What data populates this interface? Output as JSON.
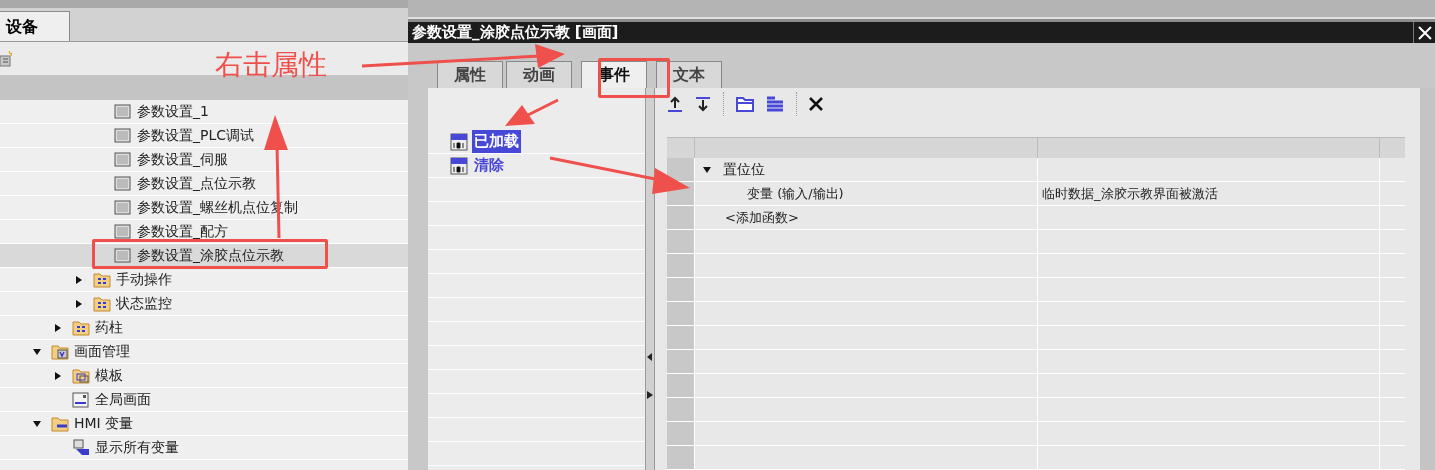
{
  "device_tab": {
    "label": "设备",
    "selected": true
  },
  "tree": {
    "items": [
      {
        "children": [
          {
            "children": [
              {
                "children": [
                  {
                    "kind": "screen",
                    "label": "参数设置_1",
                    "selected": false
                  },
                  {
                    "kind": "screen",
                    "label": "参数设置_PLC调试",
                    "selected": false
                  },
                  {
                    "kind": "screen",
                    "label": "参数设置_伺服",
                    "selected": false
                  },
                  {
                    "kind": "screen",
                    "label": "参数设置_点位示教",
                    "selected": false
                  },
                  {
                    "kind": "screen",
                    "label": "参数设置_螺丝机点位复制",
                    "selected": false
                  },
                  {
                    "kind": "screen",
                    "label": "参数设置_配方",
                    "selected": false
                  },
                  {
                    "kind": "screen",
                    "label": "参数设置_涂胶点位示教",
                    "selected": true
                  }
                ]
              },
              {
                "kind": "folder",
                "label": "手动操作",
                "expanded": false,
                "selected": false
              },
              {
                "kind": "folder",
                "label": "状态监控",
                "expanded": false,
                "selected": false
              }
            ]
          },
          {
            "kind": "folder",
            "label": "药柱",
            "expanded": false,
            "selected": false
          }
        ]
      },
      {
        "kind": "screen-folder",
        "label": "画面管理",
        "expanded": true,
        "selected": false,
        "children": [
          {
            "kind": "template",
            "label": "模板",
            "expanded": false,
            "selected": false
          },
          {
            "kind": "global",
            "label": "全局画面",
            "selected": false
          }
        ]
      },
      {
        "kind": "tag-folder",
        "label": "HMI 变量",
        "expanded": true,
        "selected": false,
        "children": [
          {
            "kind": "tags",
            "label": "显示所有变量",
            "selected": false
          }
        ]
      }
    ]
  },
  "annotation": {
    "label": "右击属性"
  },
  "dialog": {
    "title": "参数设置_涂胶点位示教 [画面]",
    "tabs": [
      {
        "label": "属性",
        "selected": false
      },
      {
        "label": "动画",
        "selected": false
      },
      {
        "label": "事件",
        "selected": true
      },
      {
        "label": "文本",
        "selected": false
      }
    ],
    "events": [
      {
        "label": "已加载",
        "selected": true
      },
      {
        "label": "清除",
        "selected": false
      }
    ],
    "functions": [
      {
        "kind": "group",
        "name": "置位位",
        "expanded": true
      },
      {
        "kind": "param",
        "name": "变量 (输入/输出)",
        "value": "临时数据_涂胶示教界面被激活"
      },
      {
        "kind": "add",
        "name": "<添加函数>"
      }
    ]
  }
}
